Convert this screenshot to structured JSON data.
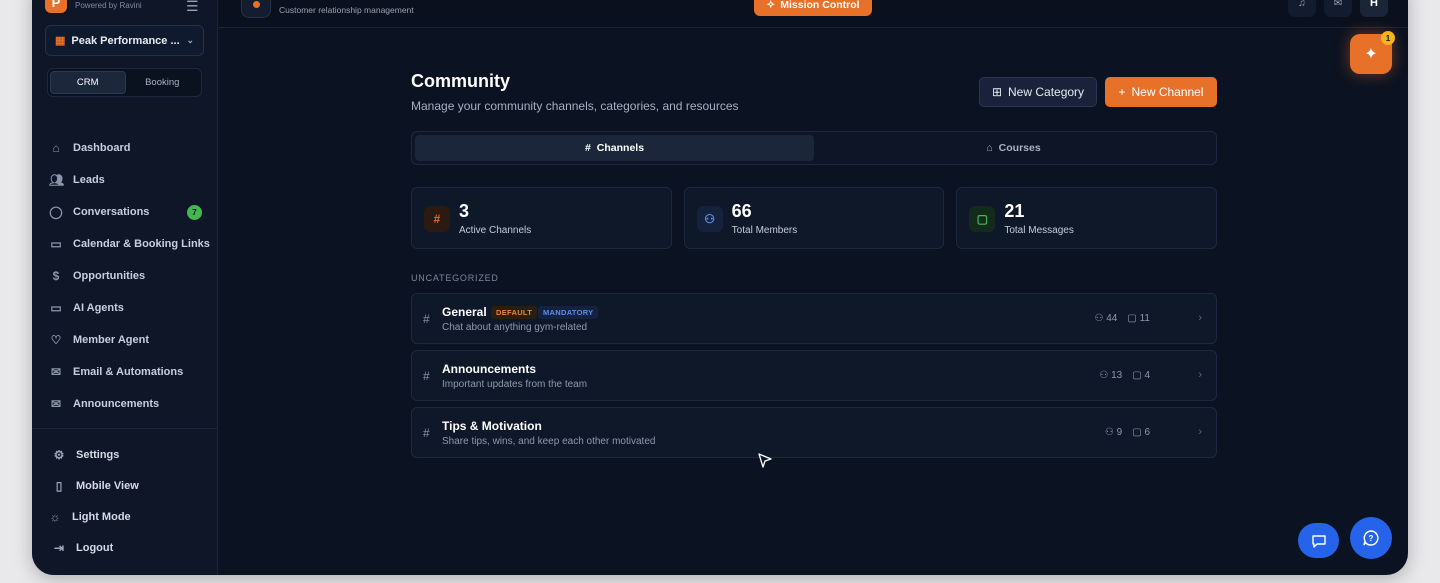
{
  "brand": {
    "logo_letter": "P",
    "subtitle": "Powered by Ravini"
  },
  "org_selector": {
    "label": "Peak Performance ..."
  },
  "mode_toggle": {
    "options": [
      "CRM",
      "Booking"
    ],
    "active": "CRM"
  },
  "nav": {
    "items": [
      {
        "label": "Dashboard",
        "icon": "home-icon"
      },
      {
        "label": "Leads",
        "icon": "users-icon"
      },
      {
        "label": "Conversations",
        "icon": "chat-icon",
        "badge": "7"
      },
      {
        "label": "Calendar & Booking Links",
        "icon": "calendar-icon"
      },
      {
        "label": "Opportunities",
        "icon": "dollar-icon"
      },
      {
        "label": "AI Agents",
        "icon": "monitor-icon"
      },
      {
        "label": "Member Agent",
        "icon": "heart-icon"
      },
      {
        "label": "Email & Automations",
        "icon": "mail-icon"
      },
      {
        "label": "Announcements",
        "icon": "mail-icon"
      }
    ]
  },
  "sidebar_bottom": {
    "settings": "Settings",
    "mobile_view": "Mobile View",
    "light_mode": "Light Mode",
    "logout": "Logout"
  },
  "topbar": {
    "system_subtitle": "Customer relationship management",
    "mission_control": "Mission Control",
    "avatar_initial": "H"
  },
  "page": {
    "title": "Community",
    "subtitle": "Manage your community channels, categories, and resources",
    "new_category": "New Category",
    "new_channel": "New Channel"
  },
  "tabs": [
    {
      "label": "Channels",
      "active": true
    },
    {
      "label": "Courses",
      "active": false
    }
  ],
  "stats": [
    {
      "value": "3",
      "label": "Active Channels",
      "icon": "hash-icon",
      "color": "#e8712a"
    },
    {
      "value": "66",
      "label": "Total Members",
      "icon": "users-icon",
      "color": "#5b8ef0"
    },
    {
      "value": "21",
      "label": "Total Messages",
      "icon": "chat-icon",
      "color": "#3fb950"
    }
  ],
  "section_label": "UNCATEGORIZED",
  "channels": [
    {
      "name": "General",
      "description": "Chat about anything gym-related",
      "members": "44",
      "messages": "11",
      "tags": [
        "DEFAULT",
        "MANDATORY"
      ]
    },
    {
      "name": "Announcements",
      "description": "Important updates from the team",
      "members": "13",
      "messages": "4",
      "tags": []
    },
    {
      "name": "Tips & Motivation",
      "description": "Share tips, wins, and keep each other motivated",
      "members": "9",
      "messages": "6",
      "tags": []
    }
  ],
  "fab": {
    "ai_badge": "1"
  },
  "colors": {
    "accent": "#e8712a",
    "background": "#0b1221",
    "blue": "#2563eb"
  }
}
